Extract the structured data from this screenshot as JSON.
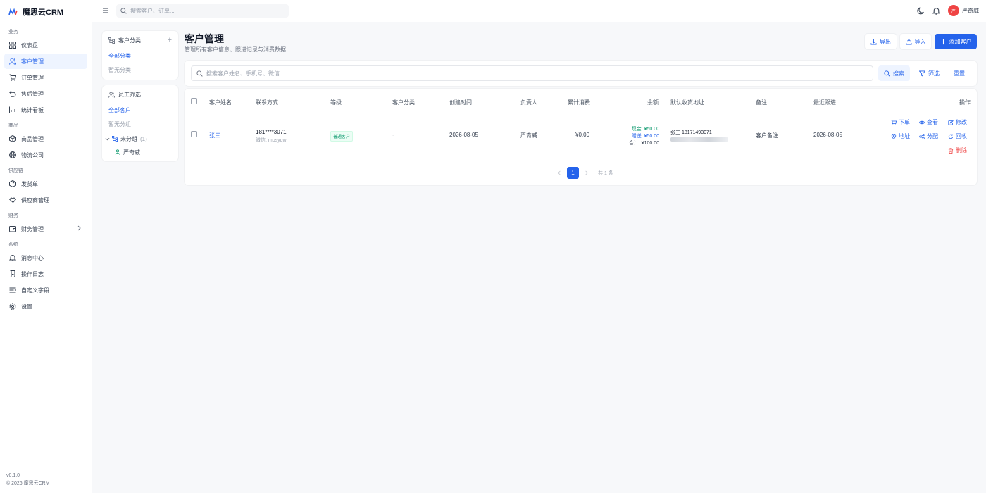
{
  "app": {
    "name": "魔思云CRM",
    "version": "v0.1.0",
    "copyright": "© 2026 魔思云CRM"
  },
  "sidebar": {
    "groups": [
      {
        "label": "业务",
        "items": [
          {
            "label": "仪表盘",
            "icon": "dashboard-icon"
          },
          {
            "label": "客户管理",
            "icon": "users-icon",
            "active": true
          },
          {
            "label": "订单管理",
            "icon": "cart-icon"
          },
          {
            "label": "售后管理",
            "icon": "undo-icon"
          },
          {
            "label": "统计看板",
            "icon": "bar-chart-icon"
          }
        ]
      },
      {
        "label": "商品",
        "items": [
          {
            "label": "商品管理",
            "icon": "box-icon"
          },
          {
            "label": "物流公司",
            "icon": "globe-icon"
          }
        ]
      },
      {
        "label": "供应链",
        "items": [
          {
            "label": "发货单",
            "icon": "package-icon"
          },
          {
            "label": "供应商管理",
            "icon": "handshake-icon"
          }
        ]
      },
      {
        "label": "财务",
        "items": [
          {
            "label": "财务管理",
            "icon": "wallet-icon",
            "has_children": true
          }
        ]
      },
      {
        "label": "系统",
        "items": [
          {
            "label": "消息中心",
            "icon": "bell-icon"
          },
          {
            "label": "操作日志",
            "icon": "scroll-icon"
          },
          {
            "label": "自定义字段",
            "icon": "list-icon"
          },
          {
            "label": "设置",
            "icon": "gear-icon"
          }
        ]
      }
    ]
  },
  "topbar": {
    "search_placeholder": "搜索客户、订单...",
    "user_name": "严奇威",
    "avatar_text": "严"
  },
  "category_panel": {
    "title": "客户分类",
    "items": [
      {
        "label": "全部分类",
        "active": true
      },
      {
        "label": "暂无分类"
      }
    ]
  },
  "staff_panel": {
    "title": "员工筛选",
    "all_label": "全部客户",
    "empty_label": "暂无分组",
    "group_label": "未分组",
    "group_count": "(1)",
    "member": "严奇威"
  },
  "page": {
    "title": "客户管理",
    "subtitle": "管理所有客户信息、跟进记录与消费数据"
  },
  "actions": {
    "export": "导出",
    "import": "导入",
    "add": "添加客户"
  },
  "search": {
    "placeholder": "搜索客户姓名、手机号、微信",
    "search_btn": "搜索",
    "filter_btn": "筛选",
    "reset_btn": "重置"
  },
  "table": {
    "headers": [
      "客户姓名",
      "联系方式",
      "等级",
      "客户分类",
      "创建时间",
      "负责人",
      "累计消费",
      "余额",
      "默认收货地址",
      "备注",
      "最近跟进",
      "操作"
    ],
    "rows": [
      {
        "name": "张三",
        "phone": "181****3071",
        "wechat": "微信: mosyqw",
        "level": "普通客户",
        "category": "-",
        "created": "2026-08-05",
        "owner": "严奇威",
        "total_spend": "¥0.00",
        "balance_cash": "现金: ¥50.00",
        "balance_gift": "赠送: ¥50.00",
        "balance_total": "合计: ¥100.00",
        "address": "张三 18171493071",
        "remark": "客户备注",
        "last_follow": "2026-08-05",
        "row_actions": {
          "order": "下单",
          "view": "查看",
          "edit": "修改",
          "address": "地址",
          "assign": "分配",
          "recycle": "回收",
          "delete": "删除"
        }
      }
    ]
  },
  "pagination": {
    "current": "1",
    "total": "共 1 条"
  },
  "colors": {
    "primary": "#2563eb",
    "danger": "#ef4444",
    "success": "#059669"
  }
}
